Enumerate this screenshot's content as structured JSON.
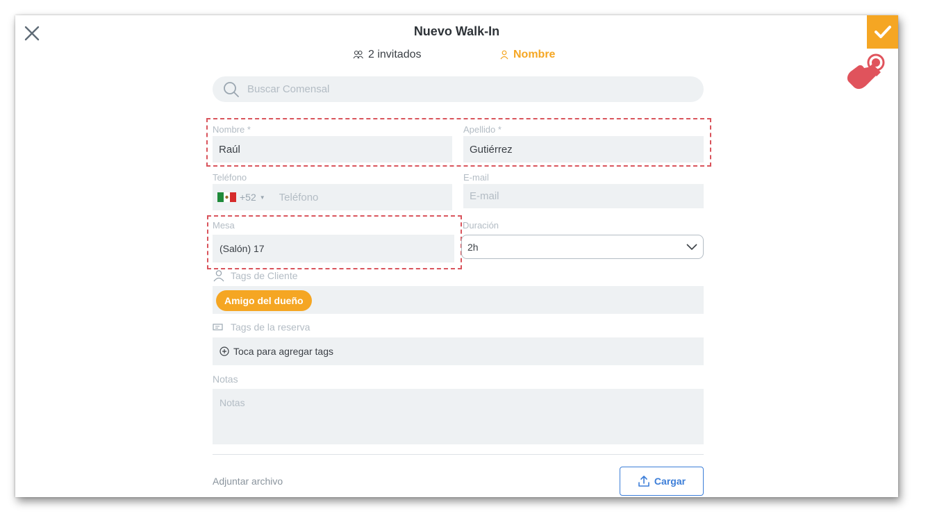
{
  "header": {
    "title": "Nuevo Walk-In",
    "guests_label": "2 invitados",
    "name_step_label": "Nombre"
  },
  "search": {
    "placeholder": "Buscar Comensal"
  },
  "form": {
    "first_name": {
      "label": "Nombre *",
      "value": "Raúl"
    },
    "last_name": {
      "label": "Apellido *",
      "value": "Gutiérrez"
    },
    "phone": {
      "label": "Teléfono",
      "country_code": "+52",
      "placeholder": "Teléfono"
    },
    "email": {
      "label": "E-mail",
      "placeholder": "E-mail"
    },
    "table": {
      "label": "Mesa",
      "value": "(Salón) 17"
    },
    "duration": {
      "label": "Duración",
      "value": "2h"
    },
    "client_tags": {
      "label": "Tags de Cliente",
      "tags": [
        "Amigo del dueño"
      ]
    },
    "reservation_tags": {
      "label": "Tags de la reserva",
      "add_label": "Toca para agregar tags"
    },
    "notes": {
      "label": "Notas",
      "placeholder": "Notas"
    }
  },
  "attachment": {
    "label": "Adjuntar archivo",
    "upload_label": "Cargar"
  },
  "colors": {
    "accent": "#f5a623",
    "highlight": "#d9545c",
    "link": "#3b7dd8",
    "field_bg": "#eef1f3"
  },
  "icons": [
    "close-icon",
    "check-icon",
    "people-icon",
    "person-icon",
    "search-icon",
    "mexico-flag-icon",
    "chevron-down-icon",
    "tag-icon",
    "plus-circle-icon",
    "upload-icon",
    "tap-hand-icon"
  ]
}
